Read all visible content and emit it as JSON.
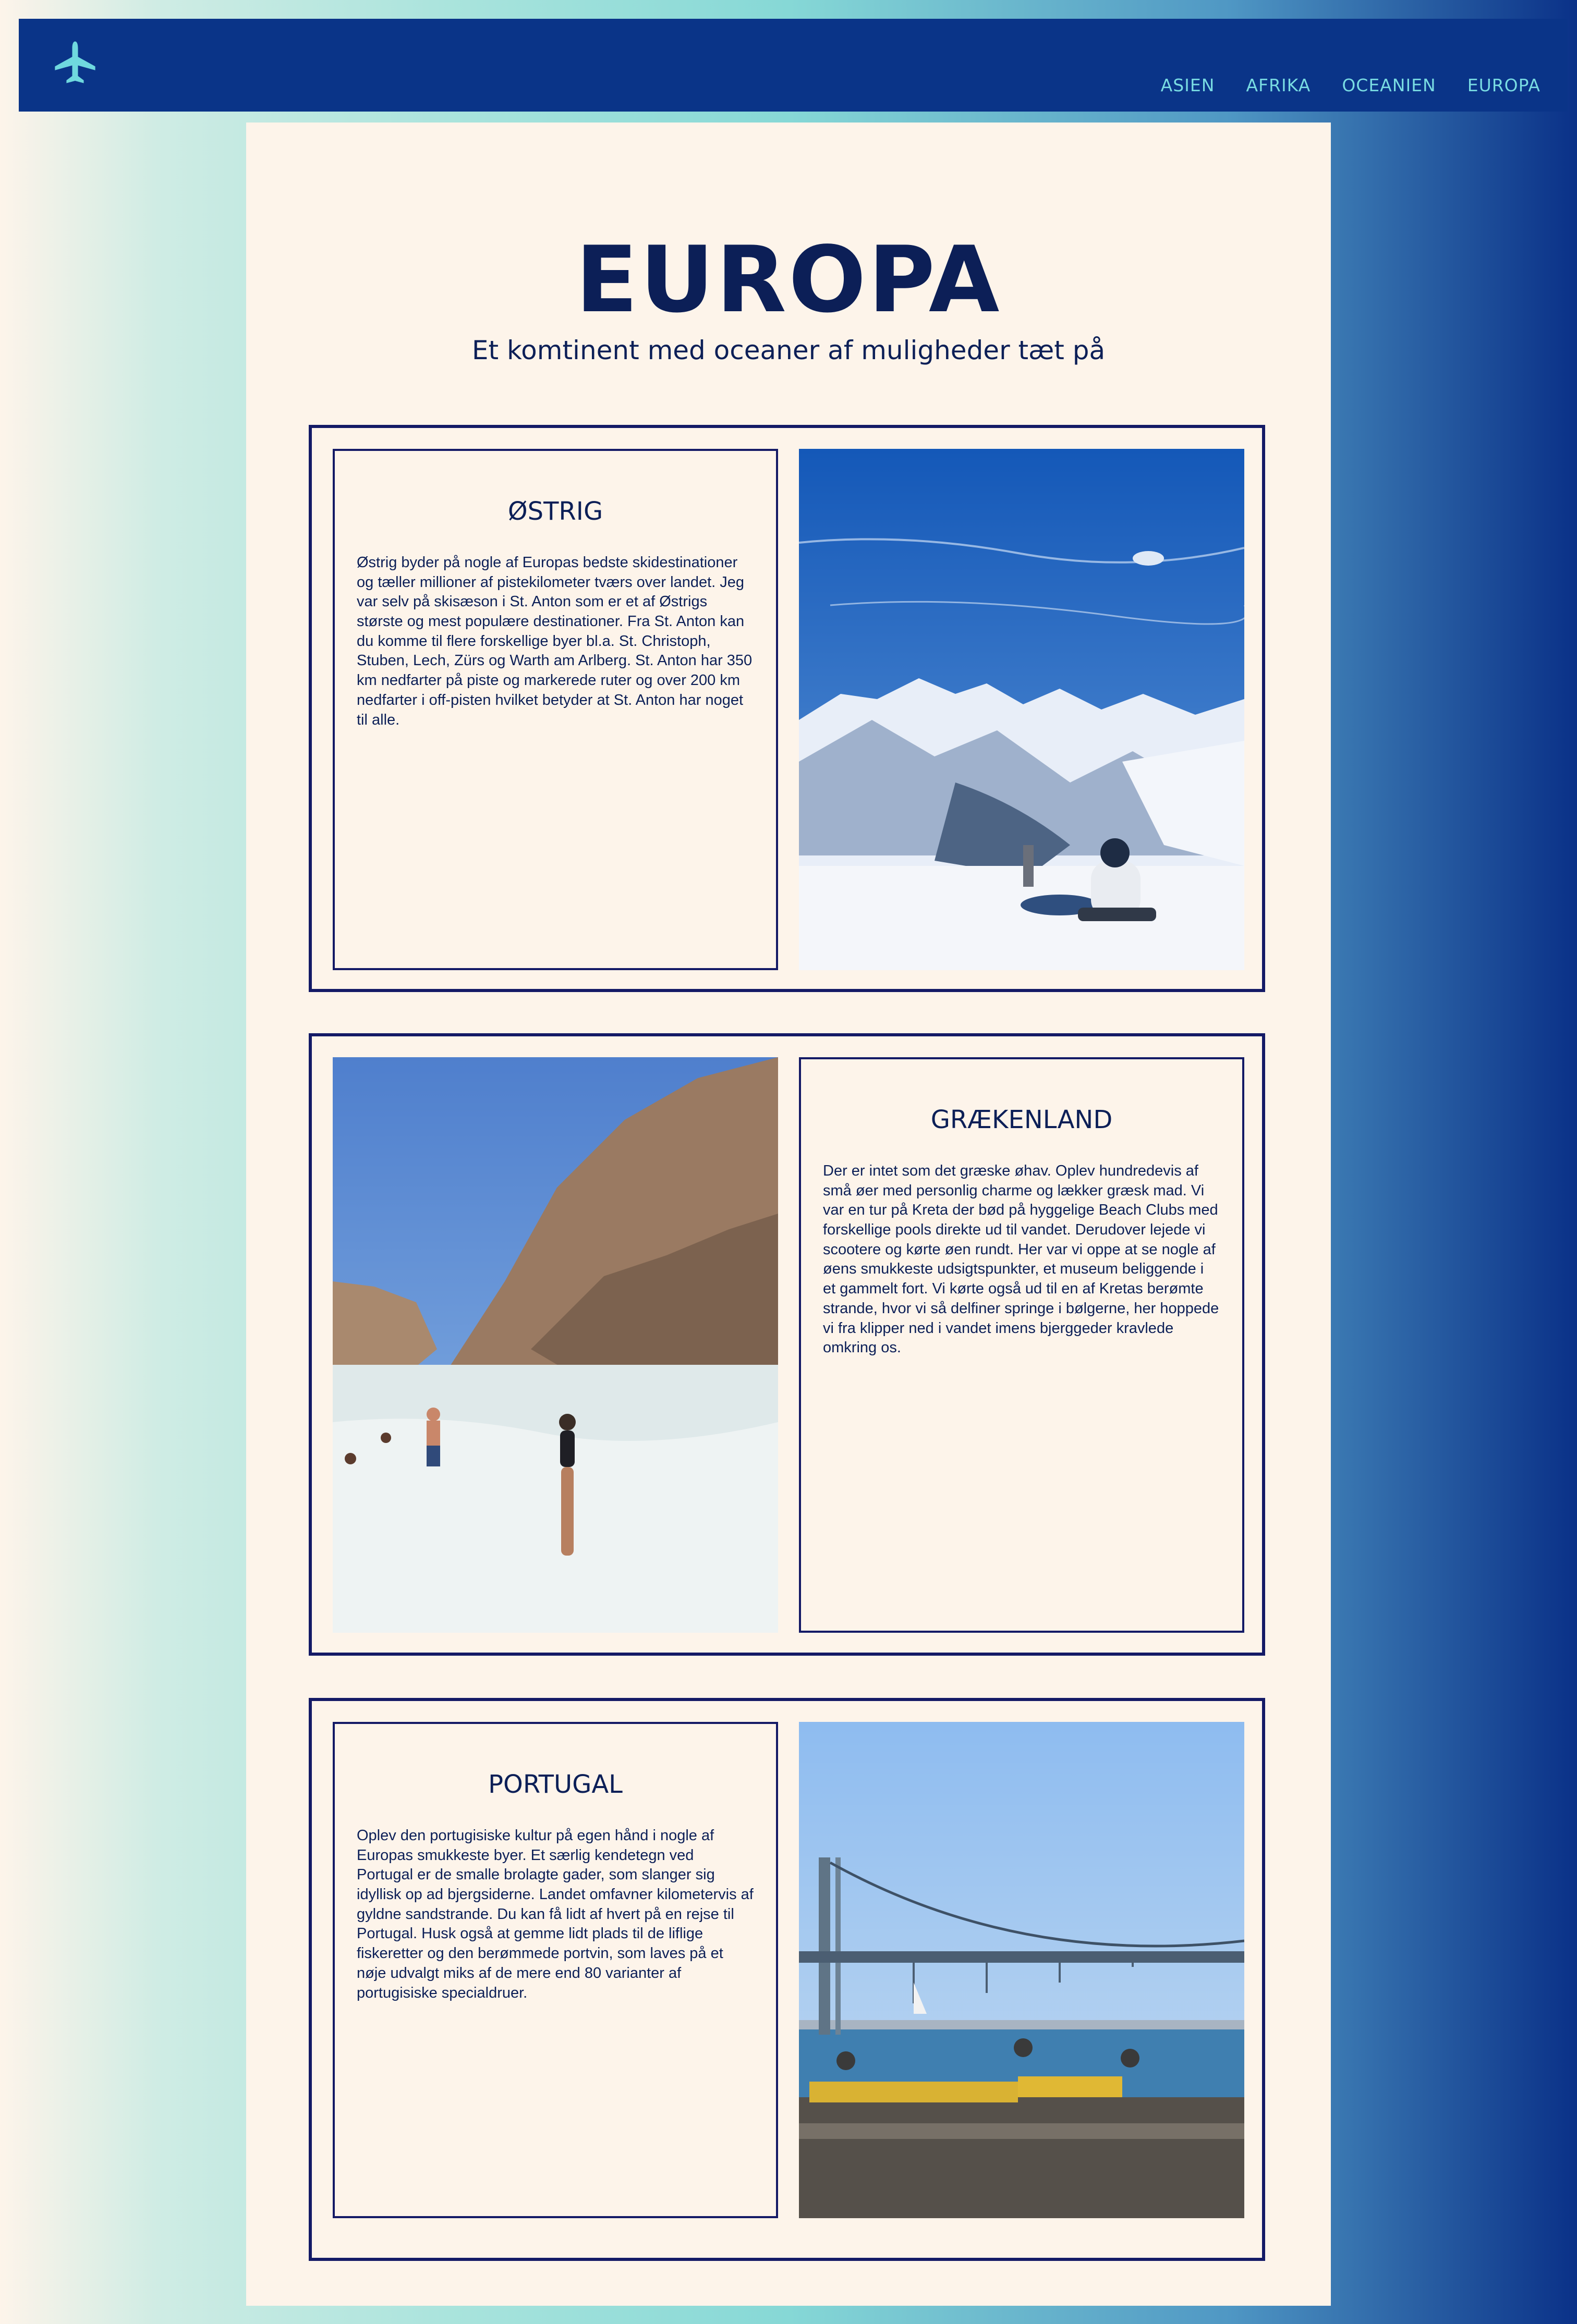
{
  "header": {
    "logo_icon": "airplane-icon",
    "nav": [
      "ASIEN",
      "AFRIKA",
      "OCEANIEN",
      "EUROPA"
    ]
  },
  "page": {
    "title": "EUROPA",
    "subtitle": "Et komtinent med oceaner af muligheder tæt på"
  },
  "sections": [
    {
      "heading": "ØSTRIG",
      "body": "Østrig byder på nogle af Europas bedste skidestinationer og tæller millioner af pistekilometer tværs over landet. Jeg var selv på skisæson i St. Anton som er et af Østrigs største og mest populære destinationer. Fra St. Anton kan du komme til flere forskellige byer bl.a. St. Christoph, Stuben, Lech, Zürs og Warth am Arlberg. St. Anton har 350 km nedfarter på piste og markerede ruter og over 200 km nedfarter i off-pisten hvilket betyder at St. Anton har noget til alle.",
      "image": "snowboarder in snowy alpine mountains"
    },
    {
      "heading": "GRÆKENLAND",
      "body": "Der er intet som det græske øhav. Oplev hundredevis af små øer med personlig charme og lækker græsk mad. Vi var en tur på Kreta der bød på hyggelige Beach Clubs med forskellige pools direkte ud til vandet. Derudover lejede vi scootere og kørte øen rundt. Her var vi oppe at se nogle af øens smukkeste udsigtspunkter, et museum beliggende i et gammelt fort. Vi kørte også ud til en af Kretas berømte strande, hvor vi så delfiner springe i bølgerne, her hoppede vi fra klipper ned i vandet imens bjerggeder kravlede omkring os.",
      "image": "woman on rocky beach in turquoise water"
    },
    {
      "heading": "PORTUGAL",
      "body": "Oplev den portugisiske kultur på egen hånd i nogle af Europas smukkeste byer. Et særlig kendetegn ved Portugal er de smalle brolagte gader, som slanger sig idyllisk op ad bjergsiderne. Landet omfavner kilometervis af gyldne sandstrande. Du kan få lidt af hvert på en rejse til Portugal. Husk også at gemme lidt plads til de liflige fiskeretter og den berømmede portvin, som laves på et nøje udvalgt miks af de mere end 80 varianter af portugisiske specialdruer.",
      "image": "suspension bridge over river with cafe terrace"
    }
  ],
  "colors": {
    "header_bg": "#0a3488",
    "nav_text": "#79dbe2",
    "panel_bg": "#fdf4ea",
    "text": "#0c1f57",
    "border": "#141a66"
  }
}
